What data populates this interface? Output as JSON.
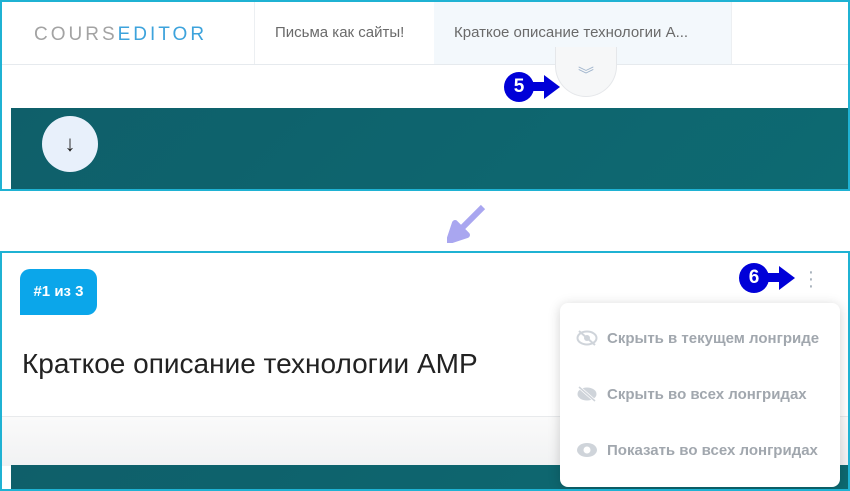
{
  "header": {
    "logo": {
      "part1": "COURS",
      "part2": "EDITOR"
    },
    "breadcrumbs": [
      "Письма как сайты!",
      "Краткое описание технологии А..."
    ]
  },
  "annotations": {
    "step5": "5",
    "step6": "6"
  },
  "collapse_icon": "double-chevron-down-icon",
  "block": {
    "badge": "#1 из 3",
    "title": "Краткое описание технологии AMP"
  },
  "menu": {
    "items": [
      {
        "label": "Скрыть в текущем лонгриде",
        "icon": "eye-off-icon"
      },
      {
        "label": "Скрыть во всех лонгридах",
        "icon": "eye-off-icon"
      },
      {
        "label": "Показать во всех лонгридах",
        "icon": "eye-icon"
      }
    ]
  },
  "colors": {
    "teal": "#0f5f6a",
    "badge": "#0ba6ea",
    "annotation": "#0000d8",
    "frame": "#1fb2d3"
  }
}
